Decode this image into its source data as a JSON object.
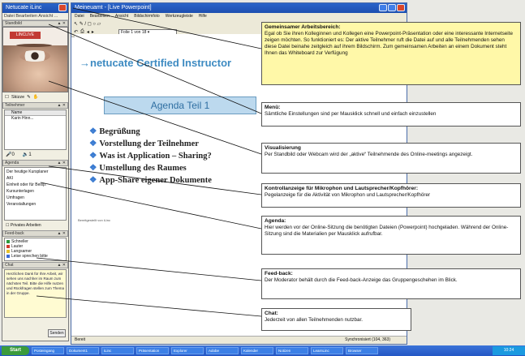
{
  "left_panel": {
    "title": "Netucate iLinc",
    "menu": "Datei  Bearbeiten  Ansicht  ...",
    "camera_head": "Standbild",
    "camera_label": "LINCLIVE",
    "tools_label": "Skizze",
    "participants_head": "Teilnehmer",
    "participants_col": "Name",
    "participant_1": "Karin Hinn...",
    "volume_mic": "0",
    "volume_speaker": "1",
    "agenda_head": "Agenda",
    "agenda_items": [
      "Der heutige Kursplaner",
      "AKI",
      "Einheit oder für Beisp.",
      "Kursunterlagen",
      "Umfragen",
      "Veranstaltungen"
    ],
    "privacy_check": "Privates Arbeiten",
    "feedback_head": "Feed-back",
    "feedback_items": [
      "Schneller",
      "Lauter",
      "Langsamer",
      "Leise sprechen bitte"
    ],
    "chat_head": "Chat",
    "chat_text": "Herzlichen Dank für Ihre Arbeit, wir sehen uns nachher im Raum zum nächsten Teil. Bitte die Hilfe nutzen und Rückfragen stellen zum Thema in der Gruppe.",
    "send_label": "Senden"
  },
  "main_window": {
    "title": "Meineuamt - [Live Powerpoint]",
    "menu": [
      "Datei",
      "Bearbeiten",
      "Ansicht",
      "Bildschirmfoto",
      "Werkzeugleiste",
      "Hilfe"
    ],
    "tool_glyphs": "↖ ✎ / ◻ ○ ▱",
    "slide_selector": "Folie 1 von 18",
    "slide_heading": "netucate Certified Instructor",
    "agenda_title": "Agenda Teil 1",
    "bullets": [
      "Begrüßung",
      "Vorstellung der Teilnehmer",
      "Was ist Application – Sharing?",
      "Umstellung des Raumes",
      "App-Share eigener Dokumente"
    ],
    "footer_note": "Bereitgestellt von iLinc",
    "status_left": "Bereit",
    "status_right": "Synchronisiert    (104, 363)"
  },
  "taskbar": {
    "start": "Start",
    "tasks": [
      "Posteingang",
      "Dokument1",
      "iLinc",
      "Präsentation",
      "Explorer",
      "Adobe",
      "Kalender",
      "Notizen",
      "LearnLinc",
      "Browser"
    ],
    "clock": "10:24"
  },
  "callouts": {
    "shared": {
      "title": "Gemeinsamer Arbeitsbereich:",
      "text": "Egal ob Sie ihren Kolleginnen und Kollegen eine Powerpoint-Präsentation oder eine interessante Internetseite zeigen möchten. So funktioniert es: Der aktive Teilnehmer ruft die Datei auf und alle Teilnehmenden sehen diese Datei beinahe zeitgleich auf ihrem Bildschirm. Zum gemeinsamen Arbeiten an einem Dokument steht Ihnen das Whiteboard zur Verfügung"
    },
    "menu": {
      "title": "Menü:",
      "text": "Sämtliche Einstellungen sind per Mausklick schnell und einfach einzustellen"
    },
    "visual": {
      "title": "Visualisierung",
      "text": "Per Standbild oder Webcam wird der „aktive“ Teilnehmende des Online-meetings angezeigt."
    },
    "control": {
      "title": "Kontrollanzeige für Mikrophon und Lautsprecher/Kopfhörer:",
      "text": "Pegelanzeige für die Aktivität von Mikrophon und Lautsprecher/Kopfhörer"
    },
    "agenda": {
      "title": "Agenda:",
      "text": "Hier werden vor der Online-Sitzung die benötigten Dateien (Powerpoint) hochgeladen. Während der Online-Sitzung sind die Materialien per Mausklick aufrufbar."
    },
    "feedback": {
      "title": "Feed-back:",
      "text": "Der Moderator behält durch die Feed-back-Anzeige das Gruppengeschehen im Blick."
    },
    "chat": {
      "title": "Chat:",
      "text": "Jederzeit von allen Teilnehmenden nutzbar."
    }
  },
  "colors": {
    "titlebar": "#1d4fb0",
    "slide_heading": "#3e8bc2",
    "callout_highlight": "#fff8a8"
  }
}
